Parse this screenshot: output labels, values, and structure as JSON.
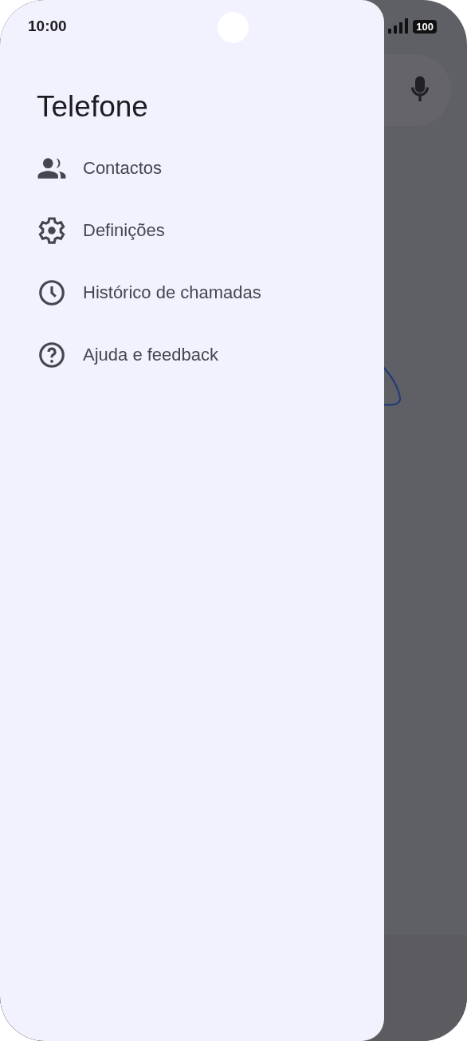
{
  "status_bar": {
    "time": "10:00",
    "battery": "100"
  },
  "drawer": {
    "title": "Telefone",
    "items": [
      {
        "kind": "people",
        "label": "Contactos"
      },
      {
        "kind": "settings",
        "label": "Definições"
      },
      {
        "kind": "history",
        "label": "Histórico de chamadas"
      },
      {
        "kind": "help",
        "label": "Ajuda e feedback"
      }
    ]
  }
}
